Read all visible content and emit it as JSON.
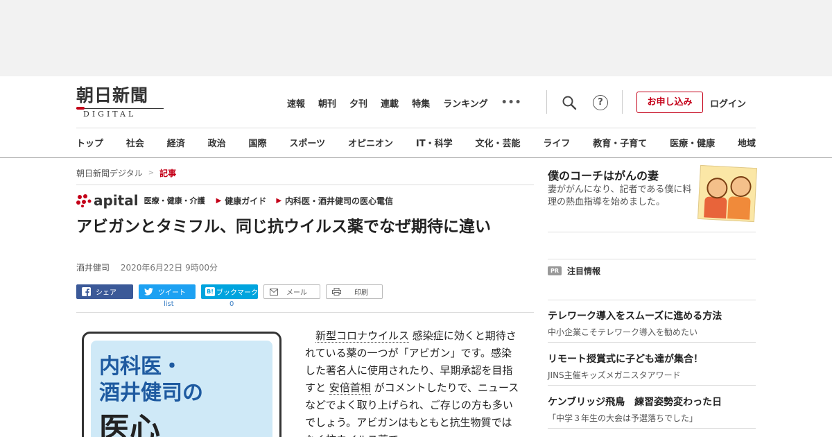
{
  "logo": {
    "name": "朝日新聞",
    "sub": "DIGITAL"
  },
  "top_nav": {
    "items": [
      "速報",
      "朝刊",
      "夕刊",
      "連載",
      "特集",
      "ランキング"
    ],
    "more": "•••"
  },
  "header": {
    "apply_label": "お申し込み",
    "login_label": "ログイン",
    "help_glyph": "?"
  },
  "categories": [
    "トップ",
    "社会",
    "経済",
    "政治",
    "国際",
    "スポーツ",
    "オピニオン",
    "IT・科学",
    "文化・芸能",
    "ライフ",
    "教育・子育て",
    "医療・健康",
    "地域"
  ],
  "breadcrumb": {
    "home": "朝日新聞デジタル",
    "sep": ">",
    "current": "記事"
  },
  "apital": {
    "logo_word": "apital",
    "tag": "医療・健康・介護",
    "links": [
      "健康ガイド",
      "内科医・酒井健司の医心電信"
    ]
  },
  "article": {
    "title": "アビガンとタミフル、同じ抗ウイルス薬でなぜ期待に違い",
    "author": "酒井健司",
    "date": "2020年6月22日 9時00分",
    "body_link1": "新型コロナウイルス",
    "body_1": " 感染症に効くと期待されている薬の一つが「アビガン」です。感染した著名人に使用されたり、早期承認を目指すと ",
    "body_link2": "安倍首相",
    "body_2": " がコメントしたりで、ニュースなどでよく取り上げられ、ご存じの方も多いでしょう。アビガンはもともと抗生物質ではなく抗ウイルス薬で",
    "image_line1": "内科医・",
    "image_line2": "酒井健司の",
    "image_line3": "医心"
  },
  "share": {
    "facebook": "シェア",
    "twitter": "ツイート",
    "hatena": "ブックマーク",
    "hatena_icon": "B!",
    "mail": "メール",
    "print": "印刷",
    "twitter_count": "list",
    "hatena_count": "0"
  },
  "sidebar": {
    "promo_title": "僕のコーチはがんの妻",
    "promo_desc": "妻ががんになり、記者である僕に料理の熱血指導を始めました。",
    "pr_badge": "PR",
    "pr_label": "注目情報",
    "items": [
      {
        "title": "テレワーク導入をスムーズに進める方法",
        "sub": "中小企業こそテレワーク導入を勧めたい"
      },
      {
        "title": "リモート授賞式に子ども達が集合！",
        "sub": "JINS主催キッズメガニスタアワード"
      },
      {
        "title": "ケンブリッジ飛鳥　練習姿勢変わった日",
        "sub": "「中学３年生の大会は予選落ちでした」"
      }
    ]
  },
  "colors": {
    "accent": "#c40018",
    "facebook": "#3b5998",
    "twitter": "#1da1f2",
    "hatena": "#00a4de"
  }
}
